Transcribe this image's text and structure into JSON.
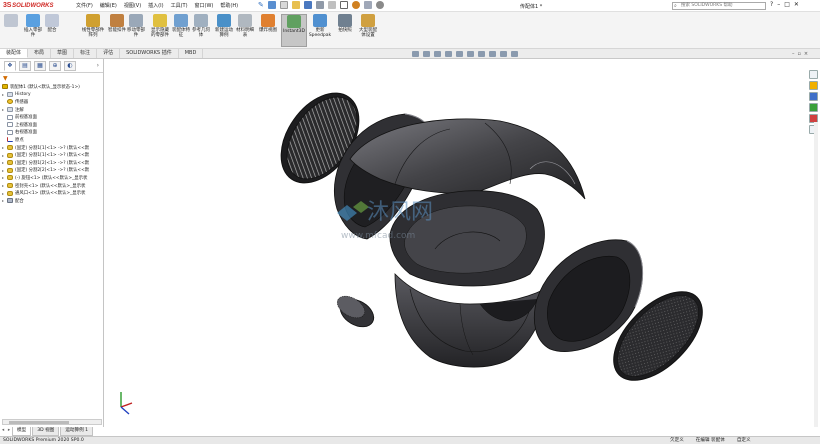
{
  "app": {
    "brand": "SOLIDWORKS",
    "window_title": "传配体1 *",
    "menu": [
      "文件(F)",
      "编辑(E)",
      "视图(V)",
      "插入(I)",
      "工具(T)",
      "窗口(W)",
      "帮助(H)"
    ],
    "search_placeholder": "搜索 SOLIDWORKS 帮助"
  },
  "ribbon": {
    "buttons": [
      {
        "label": "插入零部件",
        "icon": "insert-component-icon",
        "color": "#5aa0e0"
      },
      {
        "label": "配合",
        "icon": "mate-icon",
        "color": "#c0c8d8"
      },
      {
        "label": "线性零部件阵列",
        "icon": "linear-pattern-icon",
        "color": "#d0a030"
      },
      {
        "label": "智能扣件",
        "icon": "smart-fastener-icon",
        "color": "#c08040"
      },
      {
        "label": "移动零部件",
        "icon": "move-component-icon",
        "color": "#9aa8b8"
      },
      {
        "label": "显示隐藏的零部件",
        "icon": "show-hidden-icon",
        "color": "#e0c040"
      },
      {
        "label": "装配体特征",
        "icon": "assembly-feature-icon",
        "color": "#70a0d0"
      },
      {
        "label": "参考几何体",
        "icon": "reference-geometry-icon",
        "color": "#a0b0c0"
      },
      {
        "label": "新建运动算例",
        "icon": "motion-study-icon",
        "color": "#4a90c8"
      },
      {
        "label": "材料明细表",
        "icon": "bom-icon",
        "color": "#b0b8c0"
      },
      {
        "label": "爆炸视图",
        "icon": "exploded-view-icon",
        "color": "#e08030"
      },
      {
        "label": "Instant3D",
        "icon": "instant3d-icon",
        "color": "#60a060"
      },
      {
        "label": "更新 Speedpak",
        "icon": "speedpak-icon",
        "color": "#5090d0"
      },
      {
        "label": "拍快照",
        "icon": "snapshot-icon",
        "color": "#708090"
      },
      {
        "label": "大型装配体设置",
        "icon": "large-assembly-icon",
        "color": "#d0a040"
      }
    ],
    "active": "Instant3D"
  },
  "command_tabs": [
    "装配体",
    "布局",
    "草图",
    "标注",
    "评估",
    "SOLIDWORKS 插件",
    "MBD"
  ],
  "command_tab_selected": "装配体",
  "tree": {
    "root": "装配体1 (默认<默认_显示状态-1>)",
    "items": [
      {
        "label": "History",
        "icon": "folder",
        "expand": "▸"
      },
      {
        "label": "传感器",
        "icon": "sensor",
        "expand": ""
      },
      {
        "label": "注解",
        "icon": "folder",
        "expand": "▸"
      },
      {
        "label": "前视基准面",
        "icon": "plane",
        "expand": ""
      },
      {
        "label": "上视基准面",
        "icon": "plane",
        "expand": ""
      },
      {
        "label": "右视基准面",
        "icon": "plane",
        "expand": ""
      },
      {
        "label": "原点",
        "icon": "origin",
        "expand": ""
      },
      {
        "label": "(固定) 分割1[1]<1> ->? (默认<<默",
        "icon": "part",
        "expand": "▸"
      },
      {
        "label": "(固定) 分割1[1]<1> ->? (默认<<默",
        "icon": "part",
        "expand": "▸"
      },
      {
        "label": "(固定) 分割1[2]<1> ->? (默认<<默",
        "icon": "part",
        "expand": "▸"
      },
      {
        "label": "(固定) 分割2[2]<1> ->? (默认<<默",
        "icon": "part",
        "expand": "▸"
      },
      {
        "label": "(-) 旋钮<1> (默认<<默认>_显示状",
        "icon": "part",
        "expand": "▸"
      },
      {
        "label": "密封壳<1> (默认<<默认>_显示状",
        "icon": "part",
        "expand": "▸"
      },
      {
        "label": "通风口<1> (默认<<默认>_显示状",
        "icon": "part",
        "expand": "▸"
      },
      {
        "label": "配合",
        "icon": "mate",
        "expand": "▸"
      }
    ]
  },
  "model_tabs": [
    "模型",
    "3D 视图",
    "运动算例 1"
  ],
  "model_tab_selected": "模型",
  "status": {
    "left": "SOLIDWORKS Premium 2020 SP0.0",
    "right": [
      "欠定义",
      "在编辑 装配体",
      "自定义"
    ]
  },
  "watermark": {
    "text": "沐风网",
    "url": "www.mfcad.com"
  },
  "colors": {
    "part_body": "#3c3c40",
    "part_edge": "#151515",
    "accent_red": "#d02a26",
    "selection": "#cfe1f7"
  }
}
